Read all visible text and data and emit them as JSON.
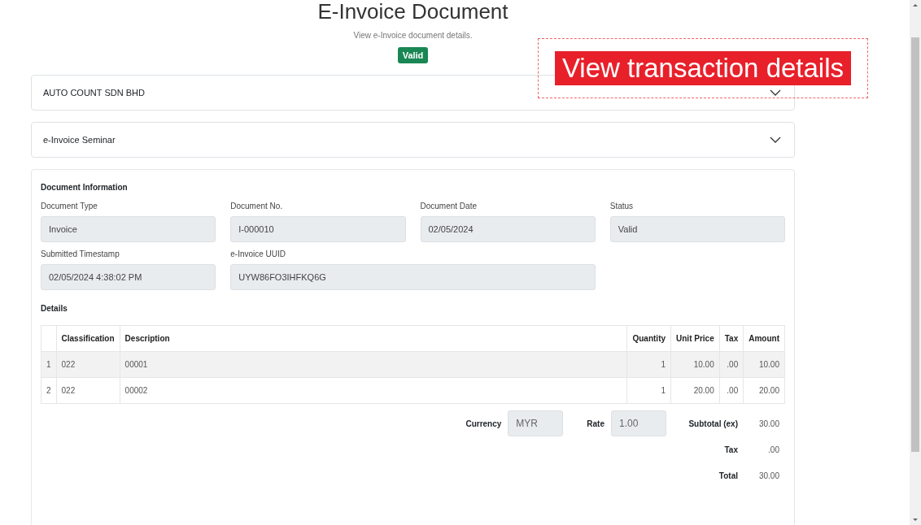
{
  "header": {
    "title": "E-Invoice Document",
    "subtitle": "View e-Invoice document details.",
    "status_badge": "Valid"
  },
  "callout": {
    "text": "View transaction details"
  },
  "accordions": [
    {
      "label": "AUTO COUNT SDN BHD",
      "expanded": false
    },
    {
      "label": "e-Invoice Seminar",
      "expanded": false
    }
  ],
  "document_information": {
    "heading": "Document Information",
    "fields": [
      {
        "label": "Document Type",
        "value": "Invoice"
      },
      {
        "label": "Document No.",
        "value": "I-000010"
      },
      {
        "label": "Document Date",
        "value": "02/05/2024"
      },
      {
        "label": "Status",
        "value": "Valid"
      },
      {
        "label": "Submitted Timestamp",
        "value": "02/05/2024 4:38:02 PM"
      },
      {
        "label": "e-Invoice UUID",
        "value": "UYW86FO3IHFKQ6G"
      }
    ]
  },
  "details": {
    "heading": "Details",
    "columns": [
      "",
      "Classification",
      "Description",
      "Quantity",
      "Unit Price",
      "Tax",
      "Amount"
    ],
    "rows": [
      [
        "1",
        "022",
        "00001",
        "1",
        "10.00",
        ".00",
        "10.00"
      ],
      [
        "2",
        "022",
        "00002",
        "1",
        "20.00",
        ".00",
        "20.00"
      ]
    ]
  },
  "summary": {
    "currency_label": "Currency",
    "currency": "MYR",
    "rate_label": "Rate",
    "rate": "1.00",
    "totals": [
      {
        "label": "Subtotal (ex)",
        "value": "30.00"
      },
      {
        "label": "Tax",
        "value": ".00"
      },
      {
        "label": "Total",
        "value": "30.00"
      }
    ]
  }
}
